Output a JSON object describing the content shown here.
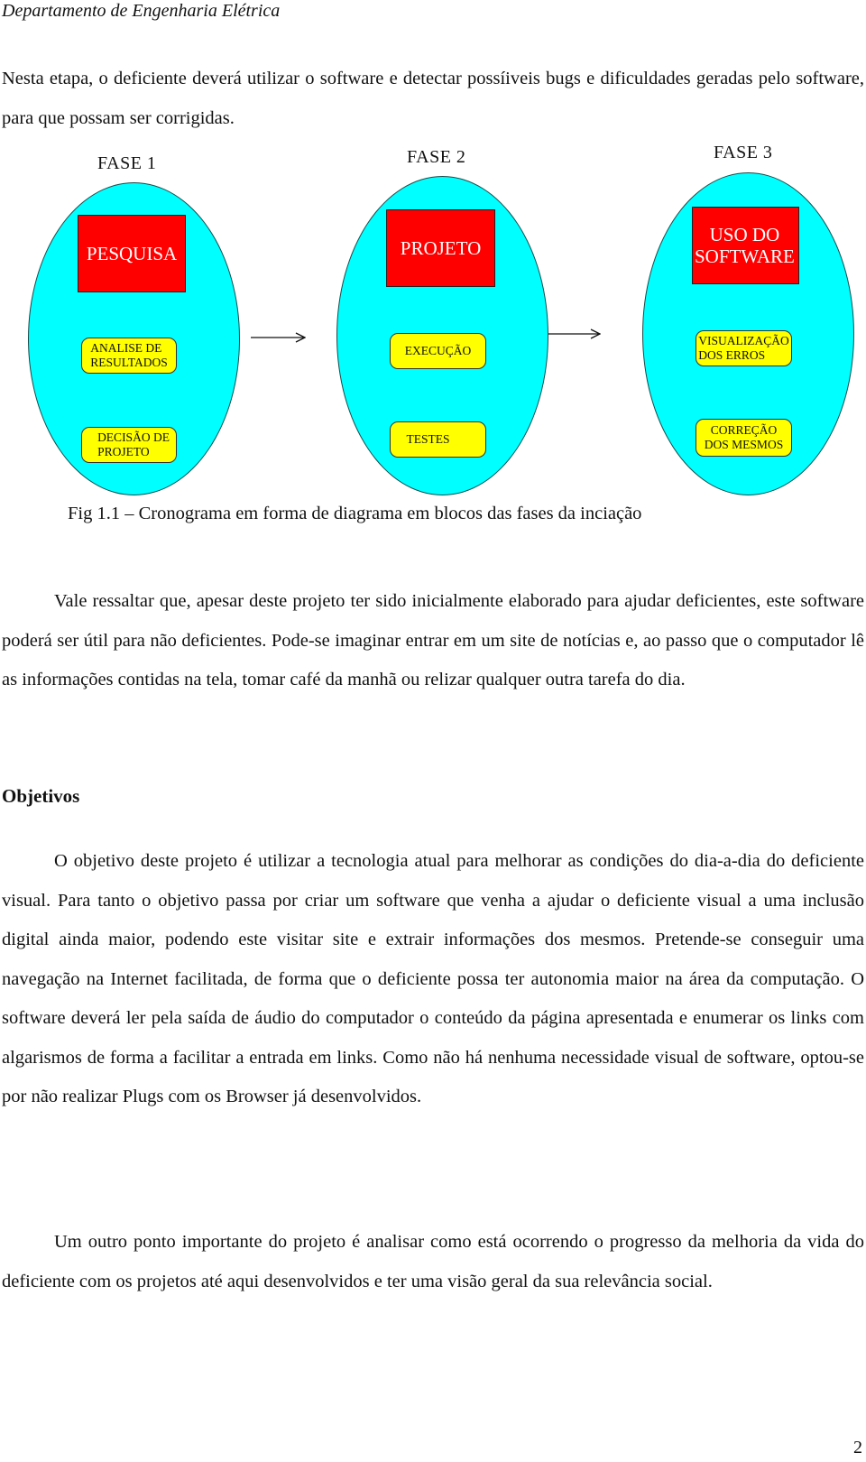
{
  "header": {
    "department": "Departamento de Engenharia Elétrica"
  },
  "intro_paragraph": "Nesta etapa, o deficiente deverá utilizar o software e detectar possíiveis bugs e dificuldades geradas pelo software, para que possam ser corrigidas.",
  "diagram": {
    "phases": [
      {
        "title": "FASE 1",
        "main_block": "PESQUISA",
        "steps": [
          "ANALISE DE\nRESULTADOS",
          "DECISÃO DE\nPROJETO"
        ]
      },
      {
        "title": "FASE 2",
        "main_block": "PROJETO",
        "steps": [
          "EXECUÇÃO",
          "TESTES"
        ]
      },
      {
        "title": "FASE 3",
        "main_block": "USO DO\nSOFTWARE",
        "steps": [
          "VISUALIZAÇÃO\nDOS ERROS",
          "CORREÇÃO\nDOS MESMOS"
        ]
      }
    ],
    "colors": {
      "ellipse": "#00ffff",
      "main_block": "#ff0000",
      "step_block": "#ffff00"
    }
  },
  "caption": "Fig 1.1 – Cronograma em forma de diagrama em blocos das fases da inciação",
  "paragraph_2": "Vale ressaltar que, apesar deste projeto ter sido inicialmente elaborado para ajudar deficientes, este software poderá ser útil para não deficientes. Pode-se imaginar entrar em um site de notícias e, ao passo que o computador lê as informações contidas na tela, tomar café da manhã ou relizar qualquer outra tarefa do dia.",
  "section_heading": "Objetivos",
  "paragraph_3": "O objetivo deste projeto é utilizar a tecnologia atual para melhorar as condições do dia-a-dia do deficiente visual. Para tanto o objetivo passa por criar um software que venha a ajudar o deficiente visual a uma inclusão digital ainda maior, podendo este visitar site e extrair informações dos mesmos. Pretende-se conseguir uma navegação na Internet facilitada, de forma que o deficiente possa ter autonomia maior na área da computação. O software deverá ler pela saída de áudio do computador o conteúdo da página apresentada e enumerar os links com algarismos de forma a facilitar a entrada em links. Como não há nenhuma necessidade visual de software, optou-se por não realizar Plugs com os Browser já desenvolvidos.",
  "paragraph_4": "Um outro ponto importante do projeto é analisar como está ocorrendo o progresso da melhoria da vida do deficiente com os projetos até aqui desenvolvidos e ter uma visão geral da sua relevância social.",
  "page_number": "2"
}
